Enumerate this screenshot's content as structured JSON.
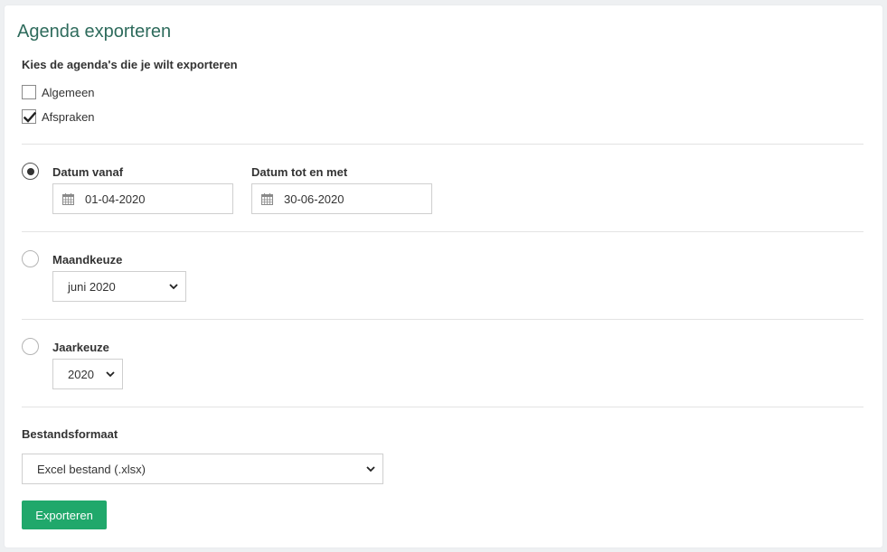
{
  "page": {
    "title": "Agenda exporteren"
  },
  "agendas": {
    "heading": "Kies de agenda's die je wilt exporteren",
    "items": [
      {
        "label": "Algemeen",
        "checked": false
      },
      {
        "label": "Afspraken",
        "checked": true
      }
    ]
  },
  "date_range": {
    "selected": true,
    "from_label": "Datum vanaf",
    "from_value": "01-04-2020",
    "to_label": "Datum tot en met",
    "to_value": "30-06-2020"
  },
  "month_choice": {
    "selected": false,
    "label": "Maandkeuze",
    "value": "juni 2020"
  },
  "year_choice": {
    "selected": false,
    "label": "Jaarkeuze",
    "value": "2020"
  },
  "file_format": {
    "label": "Bestandsformaat",
    "value": "Excel bestand (.xlsx)"
  },
  "export_button": {
    "label": "Exporteren"
  },
  "colors": {
    "title": "#2e6b5c",
    "button": "#20a86b"
  },
  "icons": {
    "calendar": "calendar-icon",
    "chevron": "chevron-down-icon",
    "check": "checkmark-icon"
  }
}
